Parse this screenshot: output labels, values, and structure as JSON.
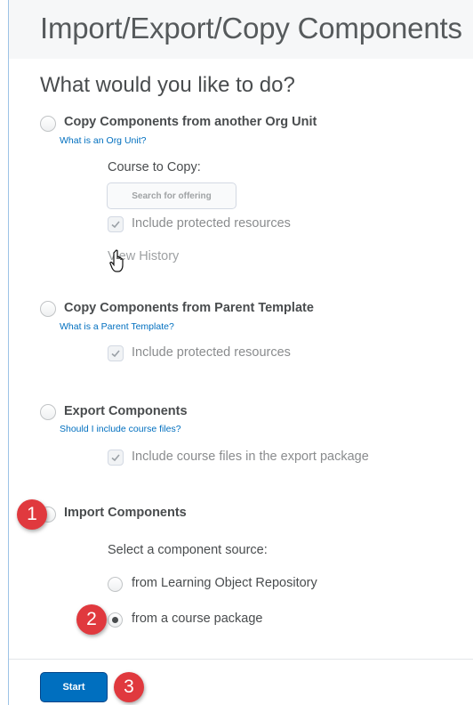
{
  "page": {
    "title": "Import/Export/Copy Components",
    "question": "What would you like to do?"
  },
  "copy_from_org": {
    "label": "Copy Components from another Org Unit",
    "help_link": "What is an Org Unit?",
    "course_label": "Course to Copy:",
    "search_placeholder": "Search for offering",
    "include_protected_label": "Include protected resources",
    "view_history_label": "View History"
  },
  "copy_from_parent": {
    "label": "Copy Components from Parent Template",
    "help_link": "What is a Parent Template?",
    "include_protected_label": "Include protected resources"
  },
  "export": {
    "label": "Export Components",
    "help_link": "Should I include course files?",
    "include_files_label": "Include course files in the export package"
  },
  "import": {
    "label": "Import Components",
    "source_prompt": "Select a component source:",
    "sources": [
      {
        "label": "from Learning Object Repository",
        "selected": false
      },
      {
        "label": "from a course package",
        "selected": true
      }
    ]
  },
  "footer": {
    "start_label": "Start"
  },
  "callouts": [
    "1",
    "2",
    "3"
  ],
  "colors": {
    "link": "#006fbf",
    "primary_button": "#006fbf",
    "callout": "#e0393e",
    "frame_border": "#9dc3e6"
  },
  "icons": {
    "checkbox_mark": "checkmark-icon",
    "pointer": "hand-pointer-cursor-icon"
  }
}
